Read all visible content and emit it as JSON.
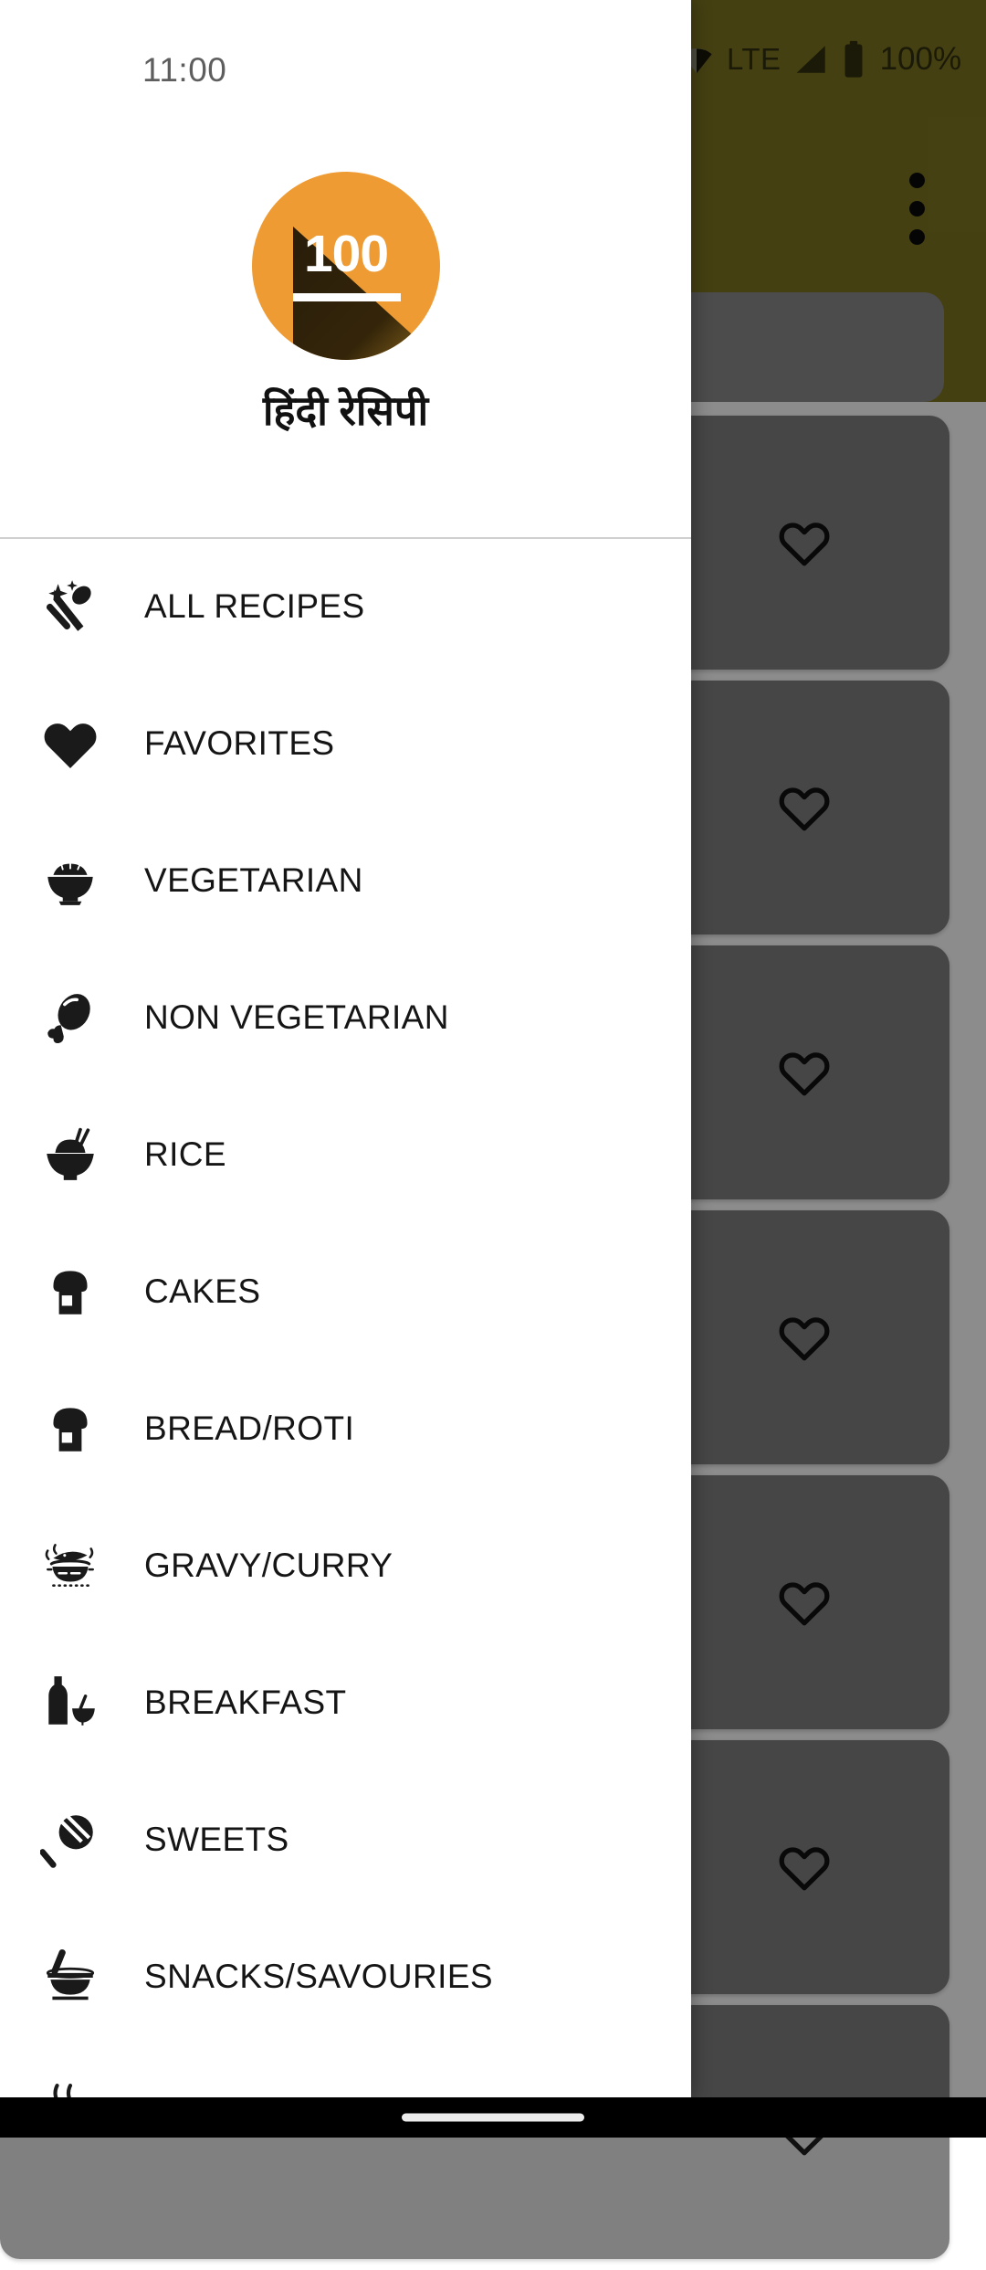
{
  "status_bar": {
    "time": "11:00",
    "network_label": "LTE",
    "battery_percent": "100%",
    "icons": [
      "wifi-icon",
      "signal-icon",
      "battery-icon"
    ]
  },
  "background_app": {
    "toolbar": {
      "color": "#7E7621",
      "overflow_menu_icon": "more-vert-icon"
    },
    "search_bar": {
      "color": "#8B8B8B"
    },
    "recipe_cards": [
      {
        "favorite_icon": "heart-outline-icon"
      },
      {
        "favorite_icon": "heart-outline-icon"
      },
      {
        "favorite_icon": "heart-outline-icon"
      },
      {
        "favorite_icon": "heart-outline-icon"
      },
      {
        "favorite_icon": "heart-outline-icon"
      },
      {
        "favorite_icon": "heart-outline-icon"
      },
      {
        "favorite_icon": "heart-outline-icon"
      }
    ]
  },
  "drawer": {
    "logo": {
      "text": "100",
      "background_color": "#EE9B33",
      "text_color": "#FFFFFF"
    },
    "app_title": "हिंदी रेसिपी",
    "items": [
      {
        "label": "ALL RECIPES",
        "icon": "spoon-fork-sparkle-icon"
      },
      {
        "label": "FAVORITES",
        "icon": "heart-filled-icon"
      },
      {
        "label": "VEGETARIAN",
        "icon": "salad-bowl-icon"
      },
      {
        "label": "NON VEGETARIAN",
        "icon": "chicken-drumstick-icon"
      },
      {
        "label": "RICE",
        "icon": "rice-bowl-chopsticks-icon"
      },
      {
        "label": "CAKES",
        "icon": "bread-loaf-icon"
      },
      {
        "label": "BREAD/ROTI",
        "icon": "bread-loaf-icon"
      },
      {
        "label": "GRAVY/CURRY",
        "icon": "cooking-pot-steam-icon"
      },
      {
        "label": "BREAKFAST",
        "icon": "milk-bottle-bowl-icon"
      },
      {
        "label": "SWEETS",
        "icon": "lollipop-icon"
      },
      {
        "label": "SNACKS/SAVOURIES",
        "icon": "mortar-pestle-icon"
      }
    ]
  },
  "system_nav": {
    "home_indicator": "home-indicator-pill"
  }
}
